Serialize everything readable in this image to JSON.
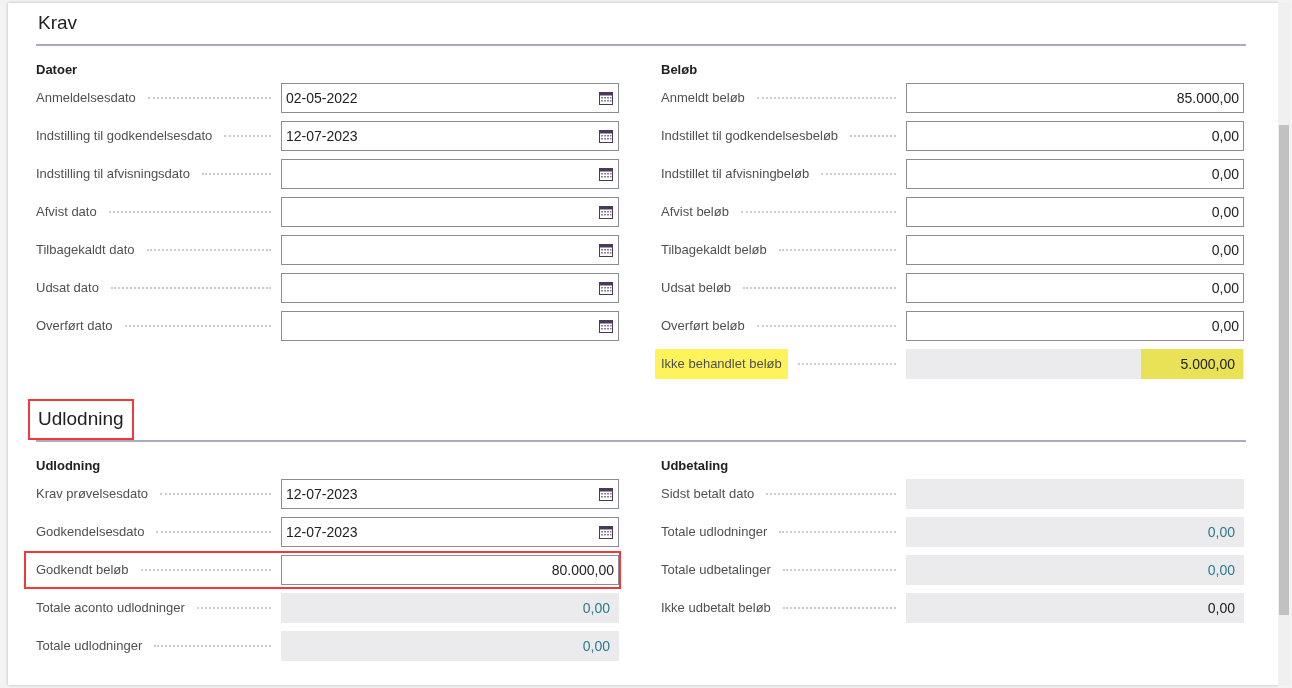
{
  "sections": [
    {
      "title": "Krav",
      "annotated": false,
      "groups": [
        {
          "title": "Datoer",
          "fields": [
            {
              "label": "Anmeldelsesdato",
              "kind": "date",
              "value": "02-05-2022"
            },
            {
              "label": "Indstilling til godkendelsesdato",
              "kind": "date",
              "value": "12-07-2023"
            },
            {
              "label": "Indstilling til afvisningsdato",
              "kind": "date"
            },
            {
              "label": "Afvist dato",
              "kind": "date"
            },
            {
              "label": "Tilbagekaldt dato",
              "kind": "date"
            },
            {
              "label": "Udsat dato",
              "kind": "date"
            },
            {
              "label": "Overført dato",
              "kind": "date"
            }
          ]
        },
        {
          "title": "Beløb",
          "fields": [
            {
              "label": "Anmeldt beløb",
              "kind": "amount",
              "value": "85.000,00"
            },
            {
              "label": "Indstillet til godkendelsesbeløb",
              "kind": "amount",
              "value": "0,00"
            },
            {
              "label": "Indstillet til afvisningbeløb",
              "kind": "amount",
              "value": "0,00"
            },
            {
              "label": "Afvist beløb",
              "kind": "amount",
              "value": "0,00"
            },
            {
              "label": "Tilbagekaldt beløb",
              "kind": "amount",
              "value": "0,00"
            },
            {
              "label": "Udsat beløb",
              "kind": "amount",
              "value": "0,00"
            },
            {
              "label": "Overført beløb",
              "kind": "amount",
              "value": "0,00"
            },
            {
              "label": "Ikke behandlet beløb",
              "kind": "readonly",
              "value": "5.000,00",
              "link": false,
              "highlighted": true
            }
          ]
        }
      ]
    },
    {
      "title": "Udlodning",
      "annotated": true,
      "groups": [
        {
          "title": "Udlodning",
          "fields": [
            {
              "label": "Krav prøvelsesdato",
              "kind": "date",
              "value": "12-07-2023"
            },
            {
              "label": "Godkendelsesdato",
              "kind": "date",
              "value": "12-07-2023"
            },
            {
              "label": "Godkendt beløb",
              "kind": "amount",
              "value": "80.000,00",
              "annotated": true
            },
            {
              "label": "Totale aconto udlodninger",
              "kind": "readonly",
              "value": "0,00",
              "link": true
            },
            {
              "label": "Totale udlodninger",
              "kind": "readonly",
              "value": "0,00",
              "link": true
            }
          ]
        },
        {
          "title": "Udbetaling",
          "fields": [
            {
              "label": "Sidst betalt dato",
              "kind": "readonly"
            },
            {
              "label": "Totale udlodninger",
              "kind": "readonly",
              "value": "0,00",
              "link": true
            },
            {
              "label": "Totale udbetalinger",
              "kind": "readonly",
              "value": "0,00",
              "link": true
            },
            {
              "label": "Ikke udbetalt beløb",
              "kind": "readonly",
              "value": "0,00",
              "link": false
            }
          ]
        }
      ]
    }
  ]
}
